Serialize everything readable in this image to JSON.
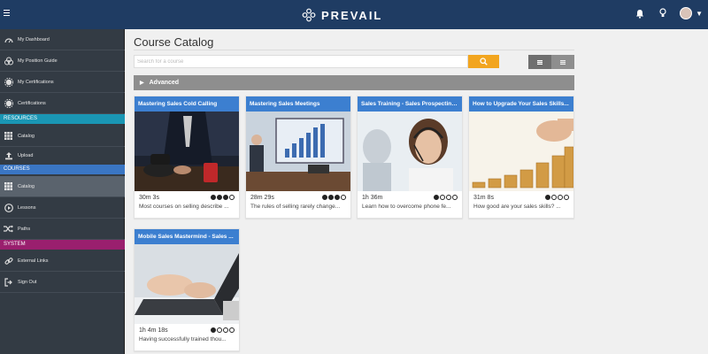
{
  "header": {
    "logo_text": "PREVAIL"
  },
  "sidebar": {
    "items": [
      {
        "label": "My Dashboard",
        "icon": "speedometer-icon"
      },
      {
        "label": "My Position Guide",
        "icon": "circles-icon"
      },
      {
        "label": "My Certifications",
        "icon": "gear-badge-icon"
      },
      {
        "label": "Certifications",
        "icon": "gear-badge-icon"
      }
    ],
    "sections": {
      "resources": "RESOURCES",
      "courses": "COURSES",
      "system": "SYSTEM"
    },
    "resources_items": [
      {
        "label": "Catalog",
        "icon": "grid-icon"
      },
      {
        "label": "Upload",
        "icon": "upload-icon"
      }
    ],
    "courses_items": [
      {
        "label": "Catalog",
        "icon": "grid-icon",
        "active": true
      },
      {
        "label": "Lessons",
        "icon": "play-circle-icon"
      },
      {
        "label": "Paths",
        "icon": "shuffle-icon"
      }
    ],
    "system_items": [
      {
        "label": "External Links",
        "icon": "link-icon"
      },
      {
        "label": "Sign Out",
        "icon": "sign-out-icon"
      }
    ]
  },
  "main": {
    "title": "Course Catalog",
    "search_placeholder": "Search for a course",
    "advanced_label": "Advanced"
  },
  "courses": [
    {
      "title": "Mastering Sales Cold Calling",
      "duration": "30m 3s",
      "level": 3,
      "description": "Most courses on selling describe ..."
    },
    {
      "title": "Mastering Sales Meetings",
      "duration": "28m 29s",
      "level": 3,
      "description": "The rules of selling rarely change..."
    },
    {
      "title": "Sales Training - Sales Prospecting...",
      "duration": "1h 36m",
      "level": 1,
      "description": "Learn how to overcome phone fe..."
    },
    {
      "title": "How to Upgrade Your Sales Skills...",
      "duration": "31m 8s",
      "level": 1,
      "description": "How good are your sales skills? ..."
    },
    {
      "title": "Mobile Sales Mastermind - Sales ...",
      "duration": "1h 4m 18s",
      "level": 1,
      "description": "Having successfully trained thou..."
    }
  ],
  "colors": {
    "topbar": "#1f3c63",
    "sidebar": "#333b44",
    "card_header": "#3c7fd0",
    "search_button": "#f2a51f",
    "section_resources": "#1a96b4",
    "section_courses": "#3a76c4",
    "section_system": "#9a1f6e"
  }
}
